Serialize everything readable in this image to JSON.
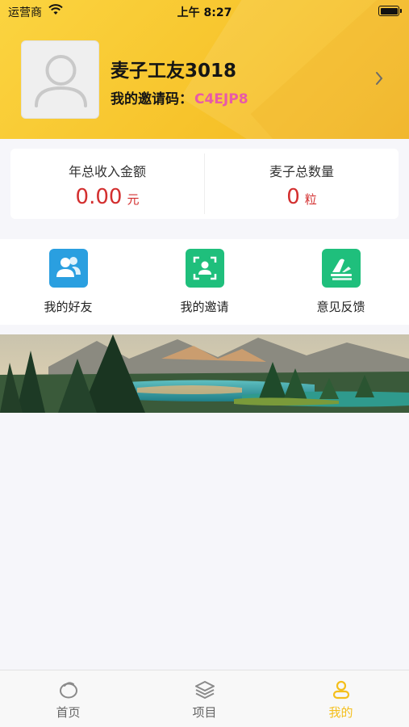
{
  "status_bar": {
    "carrier": "运营商",
    "time": "上午 8:27"
  },
  "profile": {
    "name": "麦子工友3018",
    "invite_label": "我的邀请码：",
    "invite_code": "C4EJP8"
  },
  "stats": {
    "income": {
      "label": "年总收入金额",
      "value": "0.00",
      "unit": "元"
    },
    "wheat": {
      "label": "麦子总数量",
      "value": "0",
      "unit": "粒"
    }
  },
  "actions": [
    {
      "label": "我的好友",
      "icon": "friends-icon",
      "color": "#2a9fe0"
    },
    {
      "label": "我的邀请",
      "icon": "invite-scan-icon",
      "color": "#1fbf7c"
    },
    {
      "label": "意见反馈",
      "icon": "feedback-icon",
      "color": "#1fbf7c"
    }
  ],
  "tabs": [
    {
      "label": "首页",
      "icon": "home-icon",
      "active": false
    },
    {
      "label": "项目",
      "icon": "layers-icon",
      "active": false
    },
    {
      "label": "我的",
      "icon": "user-icon",
      "active": true
    }
  ],
  "colors": {
    "header_yellow": "#f7c42c",
    "accent_yellow": "#f4bf1c",
    "value_red": "#d32f2f",
    "invite_pink": "#e85aa8",
    "blue_icon": "#2a9fe0",
    "green_icon": "#1fbf7c"
  }
}
